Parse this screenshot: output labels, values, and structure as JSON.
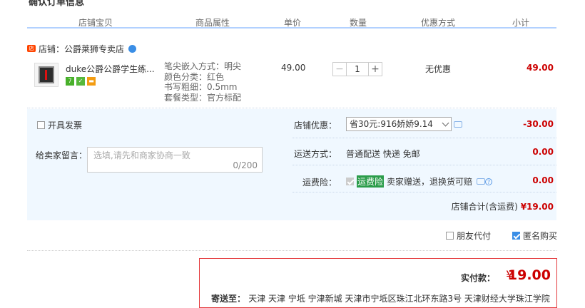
{
  "section_title": "确认订单信息",
  "columns": [
    "店铺宝贝",
    "商品属性",
    "单价",
    "数量",
    "优惠方式",
    "小计"
  ],
  "shop": {
    "label": "店铺：",
    "name": "公爵莱狮专卖店"
  },
  "item": {
    "title": "duke公爵公爵学生练...",
    "attributes": [
      "笔尖嵌入方式：明尖",
      "颜色分类：红色",
      "书写粗细：0.5mm",
      "套餐类型：官方标配"
    ],
    "price": "49.00",
    "quantity": "1",
    "minus": "−",
    "plus": "+",
    "promotion": "无优惠",
    "subtotal": "49.00",
    "badges": [
      {
        "text": "7",
        "color": "#48b02a"
      },
      {
        "text": "✓",
        "color": "#56b83a"
      },
      {
        "text": "▬",
        "color": "#f39c12"
      }
    ]
  },
  "invoice_label": "开具发票",
  "message": {
    "label": "给卖家留言：",
    "placeholder": "选填,请先和商家协商一致",
    "count": "0/200"
  },
  "shop_discount": {
    "label": "店铺优惠：",
    "selected": "省30元:916娇娇9.14",
    "amount": "-30.00"
  },
  "shipping": {
    "label": "运送方式：",
    "value": "普通配送 快递 免邮",
    "amount": "0.00"
  },
  "insurance": {
    "label": "运费险：",
    "highlight": "运费险",
    "text": "卖家赠送，退换货可赔",
    "amount": "0.00"
  },
  "shop_total": {
    "label": "店铺合计(含运费)",
    "amount": "¥19.00"
  },
  "options": {
    "friend_pay": "朋友代付",
    "anonymous": "匿名购买"
  },
  "payment": {
    "label": "实付款：",
    "symbol": "¥",
    "amount": "19.00",
    "address_label": "寄送至：",
    "address": "天津 天津 宁坻 宁津新城 天津市宁坻区珠江北环东路3号 天津财经大学珠江学院"
  },
  "colors": {
    "accent_red": "#c00",
    "header_line": "#b2d1ff",
    "panel_bg": "#f0f8ff"
  }
}
